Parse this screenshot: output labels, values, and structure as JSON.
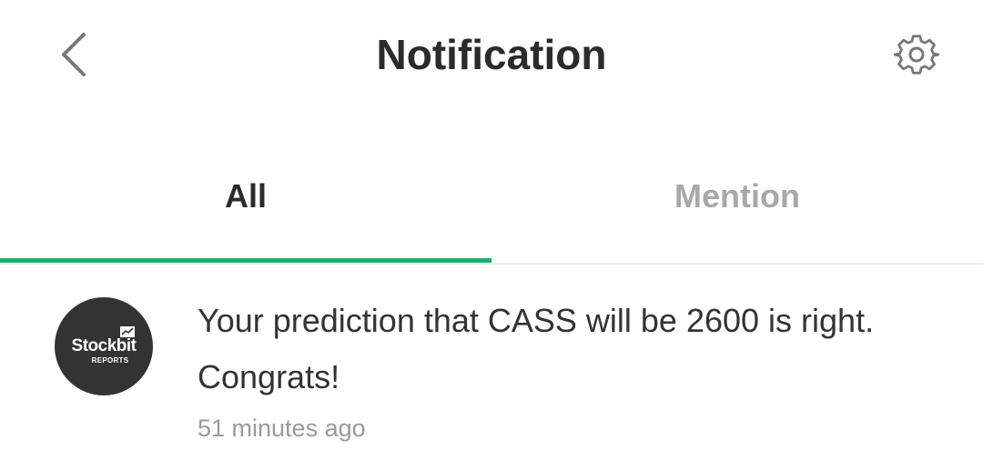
{
  "header": {
    "title": "Notification",
    "back_icon": "chevron-left-icon",
    "settings_icon": "gear-icon"
  },
  "tabs": [
    {
      "label": "All",
      "active": true
    },
    {
      "label": "Mention",
      "active": false
    }
  ],
  "colors": {
    "accent": "#1fae70",
    "title_text": "#2b2b2b",
    "inactive_tab": "#a8a8a8",
    "body_text": "#333333",
    "timestamp": "#9a9a9a",
    "avatar_bg": "#333333"
  },
  "notifications": [
    {
      "avatar": {
        "brand": "Stockbit",
        "sub": "REPORTS"
      },
      "message": "Your prediction that CASS will be 2600 is right. Congrats!",
      "time": "51 minutes ago"
    }
  ]
}
